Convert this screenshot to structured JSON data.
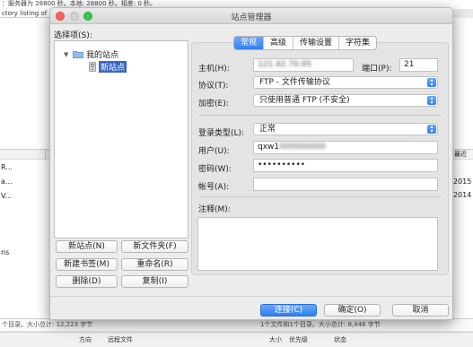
{
  "background": {
    "log_line1": "：服务器为 28800 秒。本地: 28800 秒。相差: 0 秒。",
    "log_line2": "ctory listing of",
    "left_rows": [
      "R...",
      "a...",
      "V...",
      "ns"
    ],
    "right_header": "最近",
    "right_rows": [
      "2015",
      "2014"
    ],
    "status_left": "个目录。大小总计: 12,223 字节",
    "status_right": "1个文件和1个目录。大小总计: 8,446 字节",
    "queue_cols": [
      "方向",
      "远程文件",
      "大小",
      "优先级",
      "状态"
    ]
  },
  "dialog": {
    "title": "站点管理器",
    "select_label": "选择项(S):",
    "tree": {
      "root": "我的站点",
      "selected": "新站点"
    },
    "left_buttons": {
      "new_site": "新站点(N)",
      "new_folder": "新文件夹(F)",
      "new_bookmark": "新建书签(M)",
      "rename": "重命名(R)",
      "delete": "删除(D)",
      "copy": "复制(I)"
    },
    "tabs": [
      "常规",
      "高级",
      "传输设置",
      "字符集"
    ],
    "form": {
      "host_label": "主机(H):",
      "host_value": "121.42.70.95",
      "port_label": "端口(P):",
      "port_value": "21",
      "protocol_label": "协议(T):",
      "protocol_value": "FTP - 文件传输协议",
      "encryption_label": "加密(E):",
      "encryption_value": "只使用普通 FTP (不安全)",
      "logon_type_label": "登录类型(L):",
      "logon_type_value": "正常",
      "user_label": "用户(U):",
      "user_value_visible": "qxw1",
      "user_value_blurred": "000000000",
      "password_label": "密码(W):",
      "password_value": "••••••••••",
      "account_label": "帐号(A):",
      "account_value": "",
      "notes_label": "注释(M):",
      "notes_value": ""
    },
    "bottom_buttons": {
      "connect": "连接(C)",
      "ok": "确定(O)",
      "cancel": "取消"
    }
  }
}
